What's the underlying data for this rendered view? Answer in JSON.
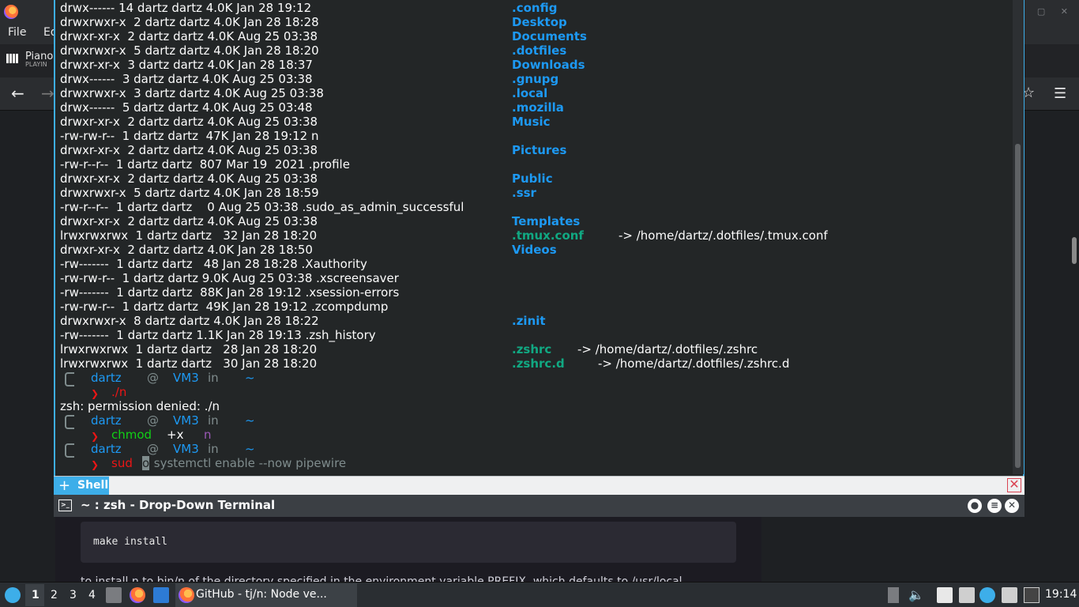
{
  "browser": {
    "menu": [
      "File",
      "Ed"
    ],
    "media_title": "Piano",
    "media_status": "PLAYIN",
    "code_snippet": "make install",
    "fade_text": "to install n to bin/n of the directory specified in the environment variable PREFIX, which defaults to /usr/local"
  },
  "terminal": {
    "listing_left": [
      "drwx------ 14 dartz dartz 4.0K Jan 28 19:12",
      "drwxrwxr-x  2 dartz dartz 4.0K Jan 28 18:28",
      "drwxr-xr-x  2 dartz dartz 4.0K Aug 25 03:38",
      "drwxrwxr-x  5 dartz dartz 4.0K Jan 28 18:20",
      "drwxr-xr-x  3 dartz dartz 4.0K Jan 28 18:37",
      "drwx------  3 dartz dartz 4.0K Aug 25 03:38",
      "drwxrwxr-x  3 dartz dartz 4.0K Aug 25 03:38",
      "drwx------  5 dartz dartz 4.0K Aug 25 03:48",
      "drwxr-xr-x  2 dartz dartz 4.0K Aug 25 03:38",
      "-rw-rw-r--  1 dartz dartz  47K Jan 28 19:12 n",
      "drwxr-xr-x  2 dartz dartz 4.0K Aug 25 03:38",
      "-rw-r--r--  1 dartz dartz  807 Mar 19  2021 .profile",
      "drwxr-xr-x  2 dartz dartz 4.0K Aug 25 03:38",
      "drwxrwxr-x  5 dartz dartz 4.0K Jan 28 18:59",
      "-rw-r--r--  1 dartz dartz    0 Aug 25 03:38 .sudo_as_admin_successful",
      "drwxr-xr-x  2 dartz dartz 4.0K Aug 25 03:38",
      "lrwxrwxrwx  1 dartz dartz   32 Jan 28 18:20",
      "drwxr-xr-x  2 dartz dartz 4.0K Jan 28 18:50",
      "-rw-------  1 dartz dartz   48 Jan 28 18:28 .Xauthority",
      "-rw-rw-r--  1 dartz dartz 9.0K Aug 25 03:38 .xscreensaver",
      "-rw-------  1 dartz dartz  88K Jan 28 19:12 .xsession-errors",
      "-rw-rw-r--  1 dartz dartz  49K Jan 28 19:12 .zcompdump",
      "drwxrwxr-x  8 dartz dartz 4.0K Jan 28 18:22",
      "-rw-------  1 dartz dartz 1.1K Jan 28 19:13 .zsh_history",
      "lrwxrwxrwx  1 dartz dartz   28 Jan 28 18:20",
      "lrwxrwxrwx  1 dartz dartz   30 Jan 28 18:20"
    ],
    "dirs": [
      {
        "row": 0,
        "name": ".config",
        "kind": "dir"
      },
      {
        "row": 1,
        "name": "Desktop",
        "kind": "dir"
      },
      {
        "row": 2,
        "name": "Documents",
        "kind": "dir"
      },
      {
        "row": 3,
        "name": ".dotfiles",
        "kind": "dir"
      },
      {
        "row": 4,
        "name": "Downloads",
        "kind": "dir"
      },
      {
        "row": 5,
        "name": ".gnupg",
        "kind": "dir"
      },
      {
        "row": 6,
        "name": ".local",
        "kind": "dir"
      },
      {
        "row": 7,
        "name": ".mozilla",
        "kind": "dir"
      },
      {
        "row": 8,
        "name": "Music",
        "kind": "dir"
      },
      {
        "row": 10,
        "name": "Pictures",
        "kind": "dir"
      },
      {
        "row": 12,
        "name": "Public",
        "kind": "dir"
      },
      {
        "row": 13,
        "name": ".ssr",
        "kind": "dir"
      },
      {
        "row": 15,
        "name": "Templates",
        "kind": "dir"
      },
      {
        "row": 16,
        "name": ".tmux.conf",
        "kind": "link",
        "target": "-> /home/dartz/.dotfiles/.tmux.conf"
      },
      {
        "row": 17,
        "name": "Videos",
        "kind": "dir"
      },
      {
        "row": 22,
        "name": ".zinit",
        "kind": "dir"
      },
      {
        "row": 24,
        "name": ".zshrc",
        "kind": "link",
        "target": "-> /home/dartz/.dotfiles/.zshrc"
      },
      {
        "row": 25,
        "name": ".zshrc.d",
        "kind": "link",
        "target": "-> /home/dartz/.dotfiles/.zshrc.d"
      }
    ],
    "prompt": {
      "user": "dartz",
      "at": "@",
      "host": "VM3",
      "in": "in",
      "path": "~"
    },
    "cmd1": "./n",
    "error_line": "zsh: permission denied: ./n",
    "cmd2": {
      "name": "chmod",
      "arg": "+x",
      "file": "n"
    },
    "cmd3": {
      "typed": "sud",
      "cursor": "o",
      "suggestion": " systemctl enable --now pipewire"
    },
    "tab_label": "Shell",
    "window_title": "~ : zsh - Drop-Down Terminal"
  },
  "panel": {
    "desktops": [
      "1",
      "2",
      "3",
      "4"
    ],
    "task_title": "GitHub - tj/n: Node ve...",
    "clock": "19:14"
  },
  "colors": {
    "accent": "#3daee9",
    "dir": "#1d99f3",
    "link": "#11a882",
    "error": "#ed1515",
    "ok": "#11d116"
  }
}
